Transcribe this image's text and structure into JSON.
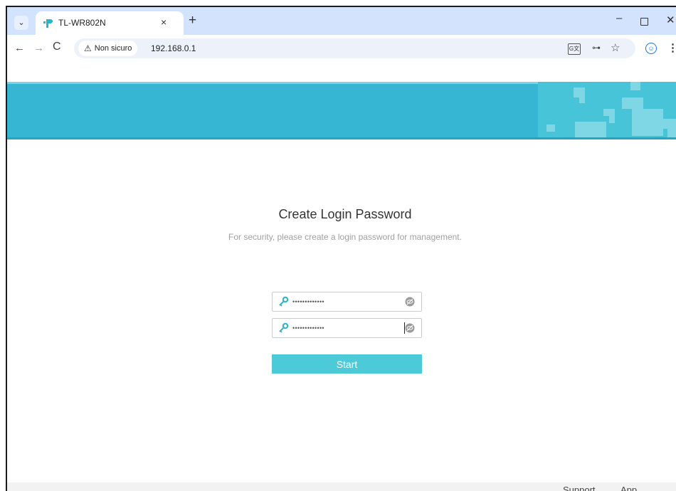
{
  "tab": {
    "title": "TL-WR802N",
    "close_glyph": "×",
    "new_tab_glyph": "+",
    "search_glyph": "⌄"
  },
  "window_controls": {
    "minimize": "–",
    "close": "✕"
  },
  "toolbar": {
    "back": "←",
    "forward": "→",
    "reload": "C",
    "security_label": "Non sicuro",
    "url": "192.168.0.1",
    "star": "☆",
    "key": "⊶",
    "menu": "⋮"
  },
  "page": {
    "title": "Create Login Password",
    "subtitle": "For security, please create a login password for management.",
    "password_1": "•••••••••••••",
    "password_2": "•••••••••••••",
    "start_button": "Start"
  },
  "footer": {
    "support": "Support",
    "app": "App"
  },
  "colors": {
    "banner": "#37b6d3",
    "button": "#4ccad8",
    "tab_strip": "#d3e3fd",
    "key_icon": "#2bb3c9"
  },
  "icons": [
    "tp-link-favicon",
    "warning-icon",
    "translate-icon",
    "key-icon",
    "star-icon",
    "profile-icon",
    "menu-icon",
    "password-key-icon",
    "eye-off-icon"
  ]
}
